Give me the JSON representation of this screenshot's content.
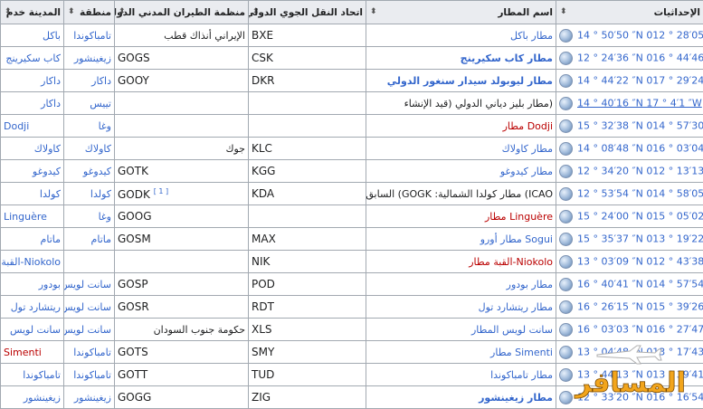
{
  "headers": {
    "coords": "الإحداثيات",
    "airport": "اسم المطار",
    "iata": "اتحاد النقل الجوي الدولي",
    "icao": "منظمة الطيران المدني الدولي",
    "region": "منطقة",
    "city": "المدينة خدم"
  },
  "rows": [
    {
      "coord": "14 ° 50′50 ″N 012 ° 28′05 ″W",
      "airport": "مطار باكل",
      "iata": "BXE",
      "icao": "الإيراني أنذاك قطب",
      "region": "تامباكوندا",
      "city": "باكل"
    },
    {
      "coord": "12 ° 24′36 ″N 016 ° 44′46 ″W",
      "airport": "مطار كاب سكيرينج",
      "iata": "CSK",
      "icao": "GOGS",
      "region": "زيغينشور",
      "city": "كاب سكيرينج"
    },
    {
      "coord": "14 ° 44′22 ″N 017 ° 29′24 ″W",
      "airport": "مطار ليوبولد سيدار سنغور الدولي",
      "iata": "DKR",
      "icao": "GOOY",
      "region": "داكار",
      "city": "داكار"
    },
    {
      "coord": "14 ° 40′16 ″N 17 ° 4′1 ″W",
      "airport": "(مطار بليز دياني الدولي (قيد الإنشاء",
      "iata": "",
      "icao": "",
      "region": "تييس",
      "city": "داكار"
    },
    {
      "coord": "15 ° 32′38 ″N 014 ° 57′30 ″W",
      "airport": "Dodji مطار",
      "iata": "",
      "icao": "",
      "region": "وغا",
      "city": "Dodji"
    },
    {
      "coord": "14 ° 08′48 ″N 016 ° 03′04 ″W",
      "airport": "مطار كاولاك",
      "iata": "KLC",
      "icao": "جوك",
      "region": "كاولاك",
      "city": "كاولاك"
    },
    {
      "coord": "12 ° 34′20 ″N 012 ° 13′13 ″W",
      "airport": "مطار كيدوغو",
      "iata": "KGG",
      "icao": "GOTK",
      "region": "كيدوغو",
      "city": "كيدوغو"
    },
    {
      "coord": "12 ° 53′54 ″N 014 ° 58′05 ″W",
      "airport": "ICAO) مطار كولدا الشمالية: GOGK) السابق",
      "iata": "KDA",
      "icao": "GODK",
      "icao_sup": "[ 1 ]",
      "region": "كولدا",
      "city": "كولدا"
    },
    {
      "coord": "15 ° 24′00 ″N 015 ° 05′02 ″W",
      "airport": "Linguère مطار",
      "iata": "",
      "icao": "GOOG",
      "region": "وغا",
      "city": "Linguère"
    },
    {
      "coord": "15 ° 35′37 ″N 013 ° 19′22 ″W",
      "airport": "Sogui مطار أورو",
      "iata": "MAX",
      "icao": "GOSM",
      "region": "ماتام",
      "city": "ماتام"
    },
    {
      "coord": "13 ° 03′09 ″N 012 ° 43′38 ″W",
      "airport": "Niokolo-القبة مطار",
      "iata": "NIK",
      "icao": "",
      "region": "",
      "city": "Niokolo-القبة"
    },
    {
      "coord": "16 ° 40′41 ″N 014 ° 57′54 ″W",
      "airport": "مطار بودور",
      "iata": "POD",
      "icao": "GOSP",
      "region": "سانت لويس",
      "city": "بودور"
    },
    {
      "coord": "16 ° 26′15 ″N 015 ° 39′26 ″W",
      "airport": "مطار ريتشارد تول",
      "iata": "RDT",
      "icao": "GOSR",
      "region": "سانت لويس",
      "city": "ريتشارد تول"
    },
    {
      "coord": "16 ° 03′03 ″N 016 ° 27′47 ″W",
      "airport": "سانت لويس المطار",
      "iata": "XLS",
      "icao": "حكومة جنوب السودان",
      "region": "سانت لويس",
      "city": "سانت لويس"
    },
    {
      "coord": "13 ° 04′48 ″N 013 ° 17′43 ″W",
      "airport": "Simenti مطار",
      "iata": "SMY",
      "icao": "GOTS",
      "region": "تامباكوندا",
      "city": "Simenti"
    },
    {
      "coord": "13 ° 44′13 ″N 013 ° 39′41 ″W",
      "airport": "مطار تامباكوندا",
      "iata": "TUD",
      "icao": "GOTT",
      "region": "تامباكوندا",
      "city": "تامباكوندا"
    },
    {
      "coord": "12 ° 33′20 ″N 016 ° 16′54 ″W",
      "airport": "مطار زيغينشور",
      "iata": "ZIG",
      "icao": "GOGG",
      "region": "زيغينشور",
      "city": "زيغينشور"
    }
  ],
  "watermark": "المسافر",
  "colors": {
    "link": "#3366cc",
    "redlink": "#ba0000",
    "header_bg": "#eaecf0",
    "border": "#a2a9b1"
  }
}
